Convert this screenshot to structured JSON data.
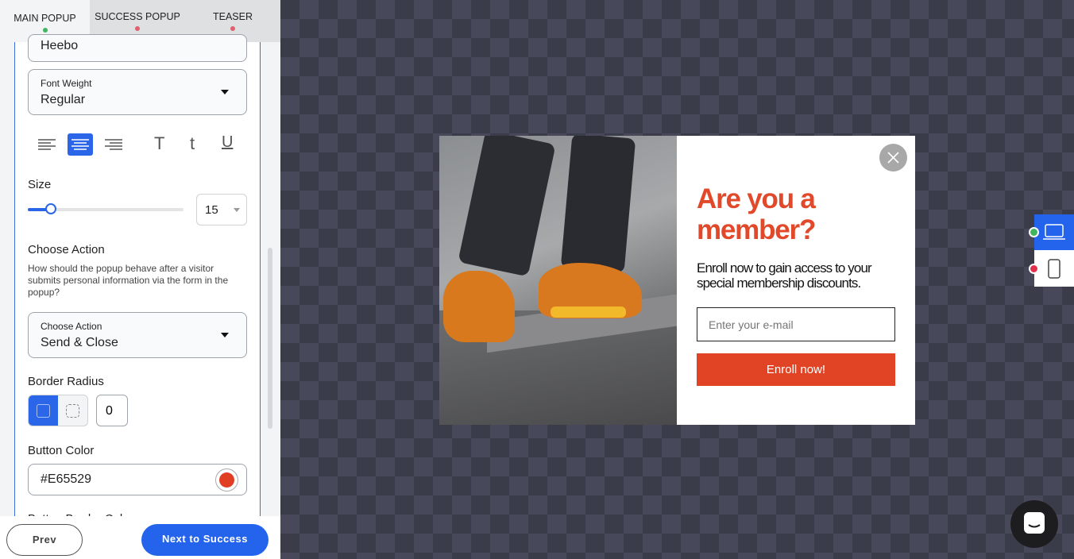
{
  "tabs": [
    {
      "label": "MAIN POPUP",
      "status_color": "#3fb55e"
    },
    {
      "label": "SUCCESS POPUP",
      "status_color": "#e06070"
    },
    {
      "label": "TEASER",
      "status_color": "#e06070"
    }
  ],
  "settings": {
    "font_family_value": "Heebo",
    "font_weight": {
      "label": "Font Weight",
      "value": "Regular"
    },
    "text_align_selected": "center",
    "size": {
      "label": "Size",
      "value": "15",
      "slider_fraction": 0.15
    },
    "choose_action": {
      "heading": "Choose Action",
      "description": "How should the popup behave after a visitor submits personal information via the form in the popup?",
      "label": "Choose Action",
      "value": "Send & Close"
    },
    "border_radius": {
      "label": "Border Radius",
      "value": "0"
    },
    "button_color": {
      "label": "Button Color",
      "value": "#E65529"
    },
    "next_label": "Button Border Color"
  },
  "footer": {
    "prev": "Prev",
    "next": "Next to Success"
  },
  "popup": {
    "title": "Are you a member?",
    "subtitle": "Enroll now to gain access to your special membership discounts.",
    "email_placeholder": "Enter your e-mail",
    "cta": "Enroll now!",
    "accent": "#E1492A",
    "button_color": "#E65529"
  },
  "device_toggle": {
    "selected": "desktop",
    "desktop_status": "#3fb55e",
    "mobile_status": "#e0304a"
  },
  "colors": {
    "primary": "#2563eb"
  }
}
